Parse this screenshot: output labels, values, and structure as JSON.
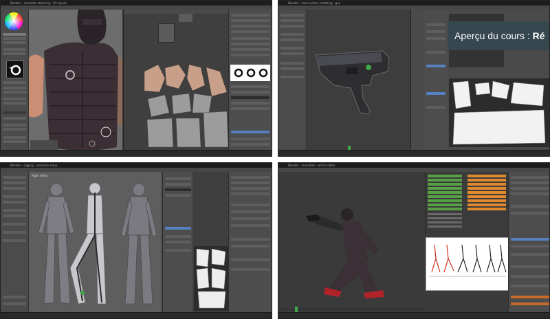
{
  "tooltip": {
    "label": "Aperçu du cours :",
    "value": "Ré"
  },
  "panels": {
    "top_left": {
      "title": "Blender - character texturing - UV layout"
    },
    "top_right": {
      "title": "Blender - hard surface modeling - gun"
    },
    "bottom_left": {
      "title": "Blender - rigging - armature setup"
    },
    "bottom_right": {
      "title": "Blender - animation - action editor"
    },
    "bottom_left_hint": {
      "text": "Right Ortho"
    }
  },
  "colors": {
    "ui_dark": "#3a3a3a",
    "ui_mid": "#4d4d4d",
    "viewport": "#6b6b6b",
    "select_blue": "#5680c2",
    "anim_orange": "#e08a2e",
    "anim_green": "#58a046",
    "tooltip_bg": "#37474f",
    "close_red": "#b13a2a"
  }
}
